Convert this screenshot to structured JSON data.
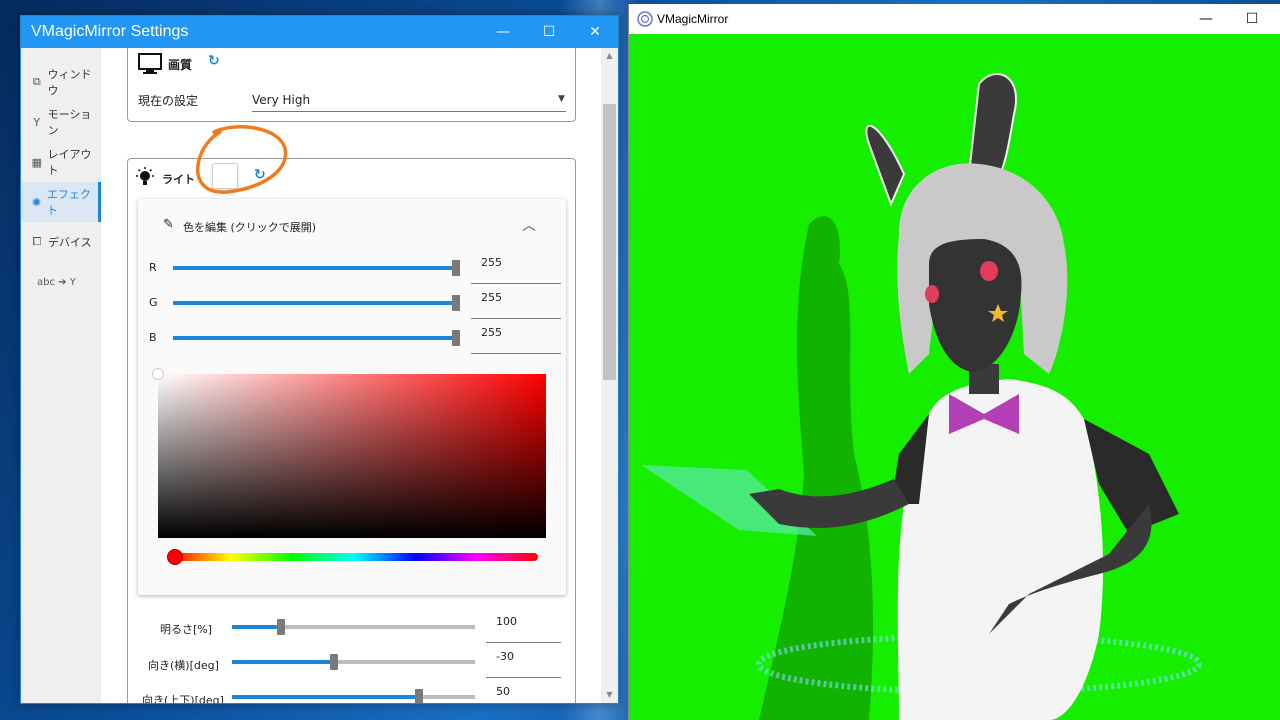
{
  "settings_window": {
    "title": "VMagicMirror Settings",
    "controls": {
      "minimize": "—",
      "maximize": "☐",
      "close": "✕"
    }
  },
  "sidebar": {
    "items": [
      {
        "icon": "window-icon",
        "glyph": "⧉",
        "label": "ウィンドウ",
        "active": false
      },
      {
        "icon": "motion-icon",
        "glyph": "Y",
        "label": "モーション",
        "active": false
      },
      {
        "icon": "layout-icon",
        "glyph": "▦",
        "label": "レイアウト",
        "active": false
      },
      {
        "icon": "effect-icon",
        "glyph": "✺",
        "label": "エフェクト",
        "active": true
      },
      {
        "icon": "device-icon",
        "glyph": "⧠",
        "label": "デバイス",
        "active": false
      },
      {
        "icon": "word-to-motion-icon",
        "glyph": "abc ➔ Y",
        "label": "",
        "active": false
      }
    ]
  },
  "quality": {
    "title": "画質",
    "current_label": "現在の設定",
    "current_value": "Very High"
  },
  "light": {
    "title": "ライト",
    "color_hex": "#ffffff",
    "editor": {
      "title": "色を編集 (クリックで展開)",
      "r_label": "R",
      "r_value": "255",
      "g_label": "G",
      "g_value": "255",
      "b_label": "B",
      "b_value": "255",
      "rgb_fraction": 1.0,
      "hue_color": "#ff0000"
    },
    "brightness_label": "明るさ[%]",
    "brightness_value": "100",
    "brightness_fraction": 0.2,
    "yaw_label": "向き(横)[deg]",
    "yaw_value": "-30",
    "yaw_fraction": 0.42,
    "pitch_label": "向き(上下)[deg]",
    "pitch_value": "50",
    "pitch_fraction": 0.77
  },
  "viewer_window": {
    "title": "VMagicMirror",
    "controls": {
      "minimize": "—",
      "maximize": "☐"
    },
    "background_color": "#16ee00"
  },
  "annotation": {
    "color": "#f07a1c"
  }
}
